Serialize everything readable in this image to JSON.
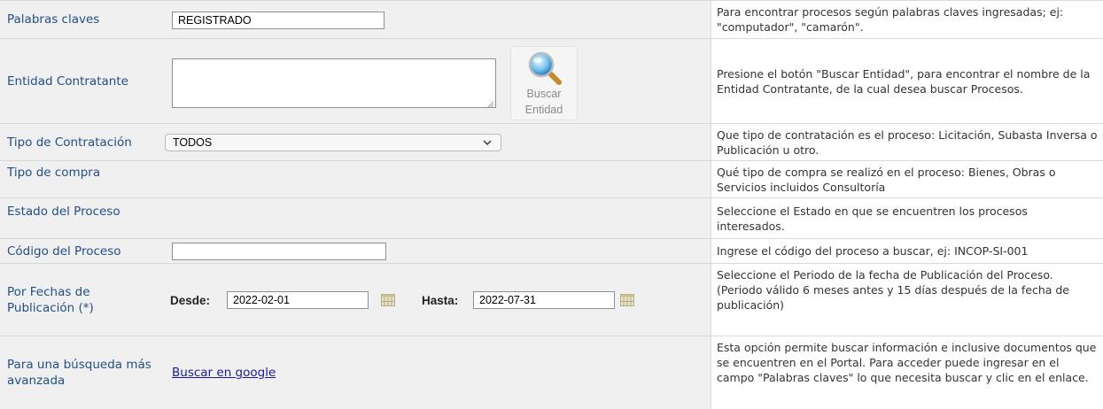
{
  "rows": {
    "keywords": {
      "label": "Palabras claves",
      "value": "REGISTRADO",
      "help": "Para encontrar procesos según palabras claves ingresadas; ej: \"computador\", \"camarón\"."
    },
    "entity": {
      "label": "Entidad Contratante",
      "value": "",
      "button_line1": "Buscar",
      "button_line2": "Entidad",
      "help": "Presione el botón \"Buscar Entidad\", para encontrar el nombre de la Entidad Contratante, de la cual desea buscar Procesos."
    },
    "contract_type": {
      "label": "Tipo de Contratación",
      "selected": "TODOS",
      "help": "Que tipo de contratación es el proceso: Licitación, Subasta Inversa o Publicación u otro."
    },
    "purchase_type": {
      "label": "Tipo de compra",
      "help": "Qué tipo de compra se realizó en el proceso: Bienes, Obras o Servicios incluidos Consultoría"
    },
    "process_state": {
      "label": "Estado del Proceso",
      "help": "Seleccione el Estado en que se encuentren los procesos interesados."
    },
    "process_code": {
      "label": "Código del Proceso",
      "value": "",
      "help": "Ingrese el código del proceso a buscar, ej: INCOP-SI-001"
    },
    "dates": {
      "label": "Por Fechas de Publicación (*)",
      "from_label": "Desde:",
      "from_value": "2022-02-01",
      "to_label": "Hasta:",
      "to_value": "2022-07-31",
      "help": "Seleccione el Periodo de la fecha de Publicación del Proceso. (Periodo válido 6 meses antes y 15 días después de la fecha de publicación)"
    },
    "advanced": {
      "label": "Para una búsqueda más avanzada",
      "link": "Buscar en google",
      "help": "Esta opción permite buscar información e inclusive documentos que se encuentren en el Portal. Para acceder puede ingresar en el campo \"Palabras claves\" lo que necesita buscar y clic en el enlace."
    }
  },
  "colors": {
    "label_text": "#1f4e8c",
    "row_bg": "#f0f0f0",
    "link": "#1a1aa6"
  }
}
